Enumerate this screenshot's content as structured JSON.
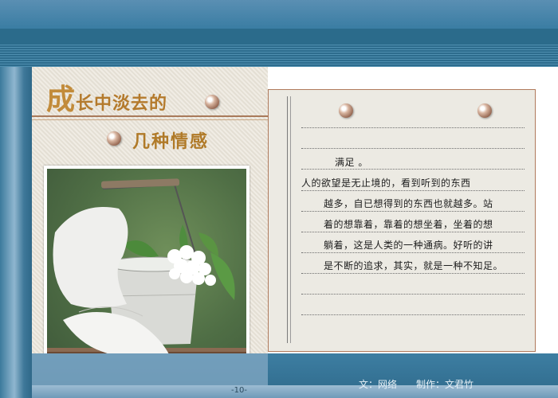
{
  "title": {
    "line1_big": "成",
    "line1_rest": "长中淡去的",
    "line2": "几种情感"
  },
  "poem": {
    "heading": "满足 。",
    "lines": [
      "人的欲望是无止境的，看到听到的东西",
      "越多，自已想得到的东西也就越多。站",
      "着的想靠着，靠着的想坐着，坐着的想",
      "躺着，这是人类的一种通病。好听的讲",
      "是不断的追求，其实，就是一种不知足。"
    ]
  },
  "footer": {
    "page_number": "-10-",
    "author": "文：网络",
    "producer": "制作：文君竹"
  },
  "colors": {
    "frame_blue": "#2e6f8e",
    "title_gold": "#b47a2c",
    "paper": "#eceae3"
  },
  "photo": {
    "subject": "white cloth draped over a metal bucket with white lilac flowers on a green background"
  }
}
